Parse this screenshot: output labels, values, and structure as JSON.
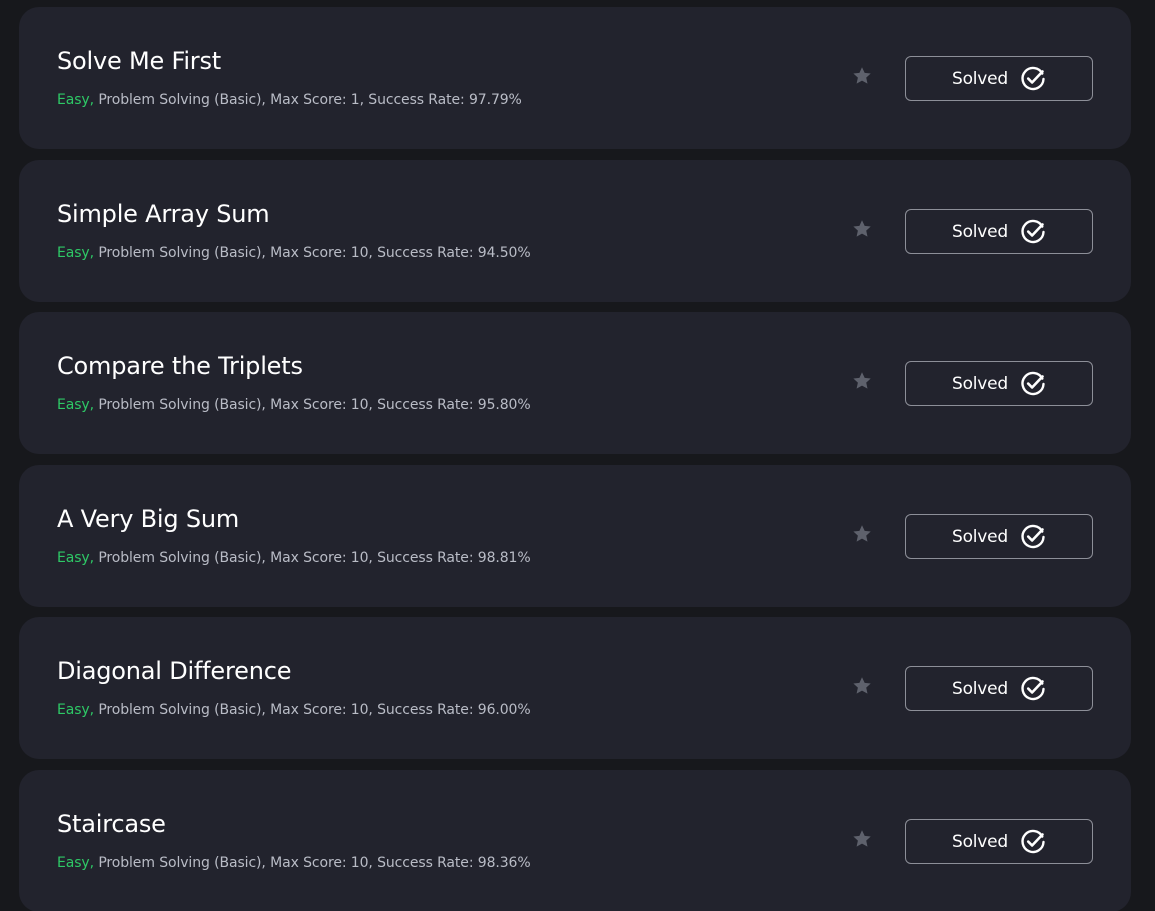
{
  "challenges": [
    {
      "title": "Solve Me First",
      "difficulty": "Easy,",
      "details": " Problem Solving (Basic), Max Score: 1, Success Rate: 97.79%",
      "action_label": "Solved"
    },
    {
      "title": "Simple Array Sum",
      "difficulty": "Easy,",
      "details": " Problem Solving (Basic), Max Score: 10, Success Rate: 94.50%",
      "action_label": "Solved"
    },
    {
      "title": "Compare the Triplets",
      "difficulty": "Easy,",
      "details": " Problem Solving (Basic), Max Score: 10, Success Rate: 95.80%",
      "action_label": "Solved"
    },
    {
      "title": "A Very Big Sum",
      "difficulty": "Easy,",
      "details": " Problem Solving (Basic), Max Score: 10, Success Rate: 98.81%",
      "action_label": "Solved"
    },
    {
      "title": "Diagonal Difference",
      "difficulty": "Easy,",
      "details": " Problem Solving (Basic), Max Score: 10, Success Rate: 96.00%",
      "action_label": "Solved"
    },
    {
      "title": "Staircase",
      "difficulty": "Easy,",
      "details": " Problem Solving (Basic), Max Score: 10, Success Rate: 98.36%",
      "action_label": "Solved"
    }
  ],
  "icons": {
    "bookmark": "star-icon",
    "status": "check-circle-icon"
  },
  "colors": {
    "background": "#17181c",
    "card": "#22232d",
    "difficulty_easy": "#2ec866",
    "star": "#5e616c",
    "text": "#ffffff",
    "meta_text": "#b9bcc6"
  }
}
